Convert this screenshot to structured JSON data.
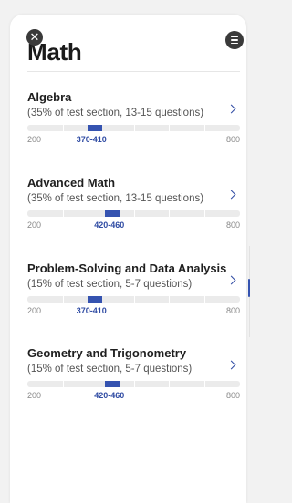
{
  "header": {
    "title": "Math",
    "close_icon": "close-icon",
    "list_icon": "list-icon"
  },
  "scale": {
    "min": "200",
    "max": "800"
  },
  "colors": {
    "accent": "#3553b0",
    "track": "#ebebeb"
  },
  "sections": [
    {
      "title": "Algebra",
      "subtitle": "(35% of test section, 13-15 questions)",
      "range": "370-410",
      "range_low": 370,
      "range_high": 410
    },
    {
      "title": "Advanced Math",
      "subtitle": "(35% of test section, 13-15 questions)",
      "range": "420-460",
      "range_low": 420,
      "range_high": 460
    },
    {
      "title": "Problem-Solving and Data Analysis",
      "subtitle": "(15% of test section, 5-7 questions)",
      "range": "370-410",
      "range_low": 370,
      "range_high": 410
    },
    {
      "title": "Geometry and Trigonometry",
      "subtitle": "(15% of test section, 5-7 questions)",
      "range": "420-460",
      "range_low": 420,
      "range_high": 460
    }
  ]
}
